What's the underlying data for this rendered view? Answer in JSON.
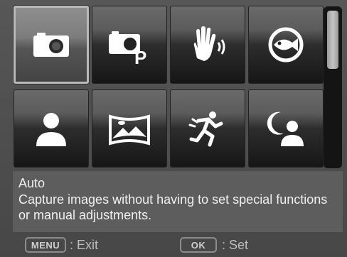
{
  "modes": [
    {
      "icon": "camera-icon",
      "selected": true
    },
    {
      "icon": "camera-program-icon",
      "selected": false
    },
    {
      "icon": "hand-stabilizer-icon",
      "selected": false
    },
    {
      "icon": "fish-eye-icon",
      "selected": false
    },
    {
      "icon": "portrait-icon",
      "selected": false
    },
    {
      "icon": "landscape-icon",
      "selected": false
    },
    {
      "icon": "sports-icon",
      "selected": false
    },
    {
      "icon": "night-portrait-icon",
      "selected": false
    }
  ],
  "description": {
    "title": "Auto",
    "text": "Capture images without having to set special functions or manual adjustments."
  },
  "footer": {
    "menu_key": "MENU",
    "menu_action": ": Exit",
    "ok_key": "OK",
    "ok_action": ": Set"
  },
  "scrollbar": {
    "position": 0
  }
}
